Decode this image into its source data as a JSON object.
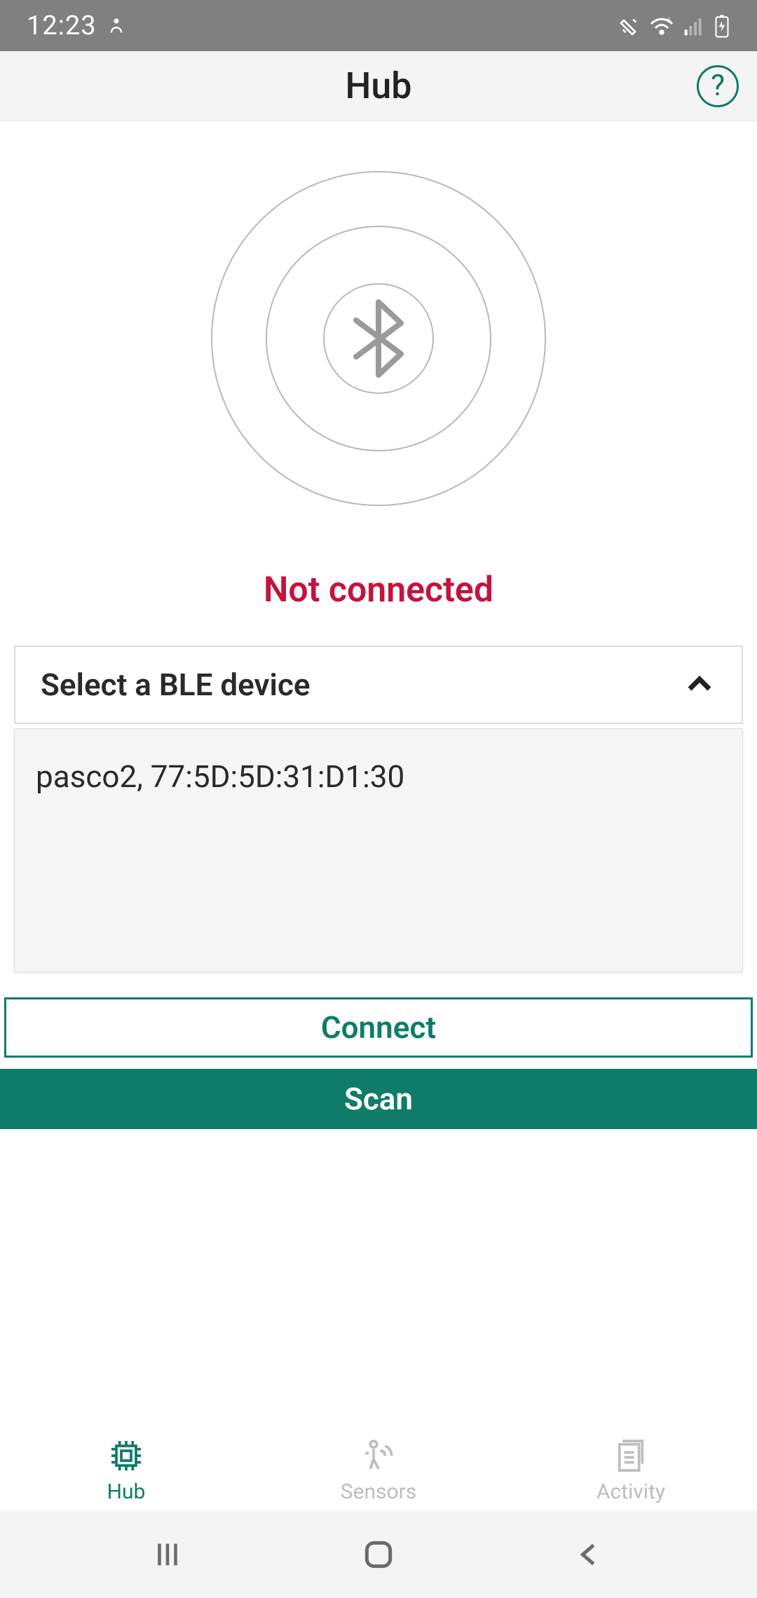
{
  "status": {
    "time": "12:23"
  },
  "appbar": {
    "title": "Hub",
    "help": "?"
  },
  "connection": {
    "status_text": "Not connected"
  },
  "selector": {
    "label": "Select a BLE device"
  },
  "devices": {
    "items": [
      "pasco2, 77:5D:5D:31:D1:30"
    ]
  },
  "buttons": {
    "connect": "Connect",
    "scan": "Scan"
  },
  "tabs": {
    "hub": "Hub",
    "sensors": "Sensors",
    "activity": "Activity"
  }
}
